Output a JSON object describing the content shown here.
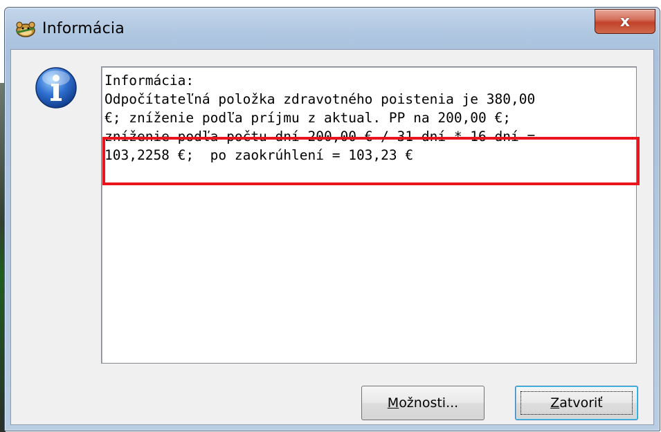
{
  "window": {
    "title": "Informácia",
    "close_glyph": "x",
    "title_icon": "hamster-app-icon",
    "info_icon": "info-icon"
  },
  "message": {
    "lines": [
      "Informácia:",
      "Odpočítateľná položka zdravotného poistenia je 380,00",
      "€; zníženie podľa príjmu z aktual. PP na 200,00 €;",
      "zníženie podľa počtu dní 200,00 € / 31 dní * 16 dní =",
      "103,2258 €;  po zaokrúhlení = 103,23 €"
    ],
    "highlight_color": "#e8151c"
  },
  "buttons": {
    "options": {
      "accel": "M",
      "rest": "ožnosti..."
    },
    "close": {
      "accel": "Z",
      "rest": "atvoriť"
    }
  }
}
